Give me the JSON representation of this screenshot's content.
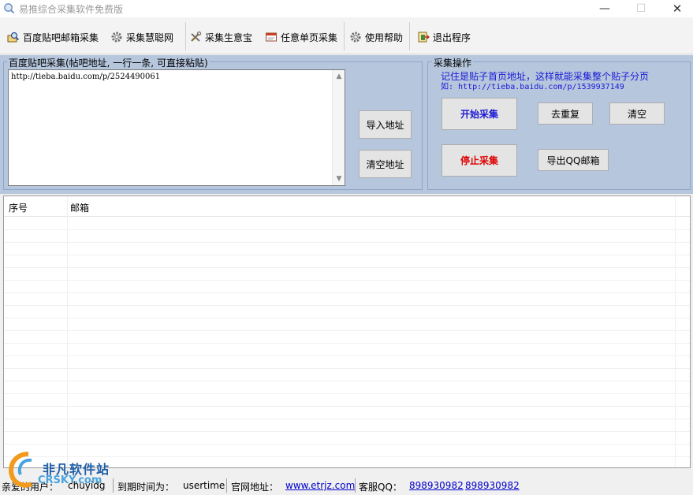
{
  "window": {
    "title": "易推综合采集软件免费版",
    "minimize": "—",
    "maximize": "☐",
    "close": "✕"
  },
  "toolbar": {
    "items": [
      {
        "label": "百度贴吧邮箱采集",
        "icon": "magnifier-icon"
      },
      {
        "label": "采集慧聪网",
        "icon": "gear-icon"
      },
      {
        "label": "采集生意宝",
        "icon": "tools-icon"
      },
      {
        "label": "任意单页采集",
        "icon": "page-icon"
      },
      {
        "label": "使用帮助",
        "icon": "gear-icon"
      },
      {
        "label": "退出程序",
        "icon": "exit-icon"
      }
    ]
  },
  "tieba_panel": {
    "legend": "百度贴吧采集(帖吧地址, 一行一条, 可直接粘贴)",
    "url_text": "http://tieba.baidu.com/p/2524490061",
    "import_button": "导入地址",
    "clear_url_button": "清空地址"
  },
  "collect_panel": {
    "legend": "采集操作",
    "hint_line1": "记住是贴子首页地址，这样就能采集整个贴子分页",
    "hint_line2": "如: http://tieba.baidu.com/p/1539937149",
    "start_button": "开始采集",
    "stop_button": "停止采集",
    "dedupe_button": "去重复",
    "clear_button": "清空",
    "export_button": "导出QQ邮箱"
  },
  "table": {
    "columns": [
      "序号",
      "邮箱"
    ],
    "rows": []
  },
  "statusbar": {
    "user_label": "亲爱的用户：",
    "user_value": "chuyidg",
    "expire_label": "到期时间为：",
    "expire_value": "usertime",
    "site_label": "官网地址：",
    "site_url": "www.etrjz.com",
    "qq_label": "客服QQ：",
    "qq_1": "898930982",
    "qq_2": "898930982"
  },
  "watermark": {
    "text": "非凡软件站",
    "sub": "CRSKY.com"
  },
  "colors": {
    "panel_bg": "#b5c6dd",
    "start_text": "#1a1ad6",
    "stop_text": "#e00000",
    "hint_text": "#1a1ad6",
    "link": "#0000cc"
  }
}
